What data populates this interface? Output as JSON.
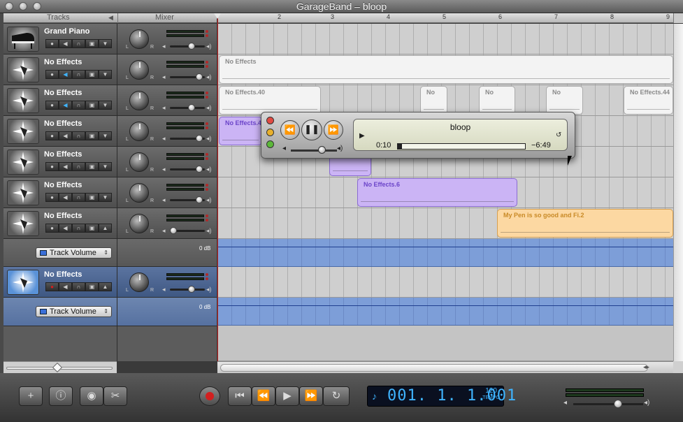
{
  "window": {
    "title": "GarageBand – bloop"
  },
  "header": {
    "tracks_label": "Tracks",
    "mixer_label": "Mixer",
    "collapse_arrow": "◀"
  },
  "ruler": {
    "numbers": [
      "2",
      "3",
      "4",
      "5",
      "6",
      "7",
      "8",
      "9"
    ]
  },
  "tracks": [
    {
      "name": "Grand Piano",
      "icon": "grand-piano-icon"
    },
    {
      "name": "No Effects",
      "icon": "starburst-instrument-icon"
    },
    {
      "name": "No Effects",
      "icon": "starburst-instrument-icon"
    },
    {
      "name": "No Effects",
      "icon": "starburst-instrument-icon"
    },
    {
      "name": "No Effects",
      "icon": "starburst-instrument-icon"
    },
    {
      "name": "No Effects",
      "icon": "starburst-instrument-icon"
    },
    {
      "name": "No Effects",
      "icon": "starburst-instrument-icon"
    },
    {
      "name": "No Effects",
      "icon": "starburst-instrument-icon"
    }
  ],
  "pan_labels": {
    "left": "L",
    "right": "R"
  },
  "automation": [
    {
      "label": "Track Volume",
      "db": "0 dB"
    },
    {
      "label": "Track Volume",
      "db": "0 dB"
    }
  ],
  "regions": [
    {
      "label": "No Effects",
      "color": "white"
    },
    {
      "label": "No Effects.40",
      "color": "white"
    },
    {
      "label": "No",
      "color": "white"
    },
    {
      "label": "No",
      "color": "white"
    },
    {
      "label": "No",
      "color": "white"
    },
    {
      "label": "No Effects.44",
      "color": "white"
    },
    {
      "label": "No Effects.4",
      "color": "purple"
    },
    {
      "label": "",
      "color": "purple"
    },
    {
      "label": "No Effects.6",
      "color": "purple"
    },
    {
      "label": "My Pen is so good and Fi.2",
      "color": "orange"
    }
  ],
  "player": {
    "title": "bloop",
    "elapsed": "0:10",
    "remaining": "−6:49"
  },
  "transport": {
    "lcd_time": "001. 1. 1.001",
    "tempo": "120",
    "tempo_label": "TEMPO"
  },
  "colors": {
    "accent": "#3fb4ff",
    "record": "#d21f1f",
    "playhead": "#c02020",
    "purple_region": "#cbb4f5",
    "orange_region": "#fcd8a2",
    "automation_lane": "#7d9ed8"
  }
}
